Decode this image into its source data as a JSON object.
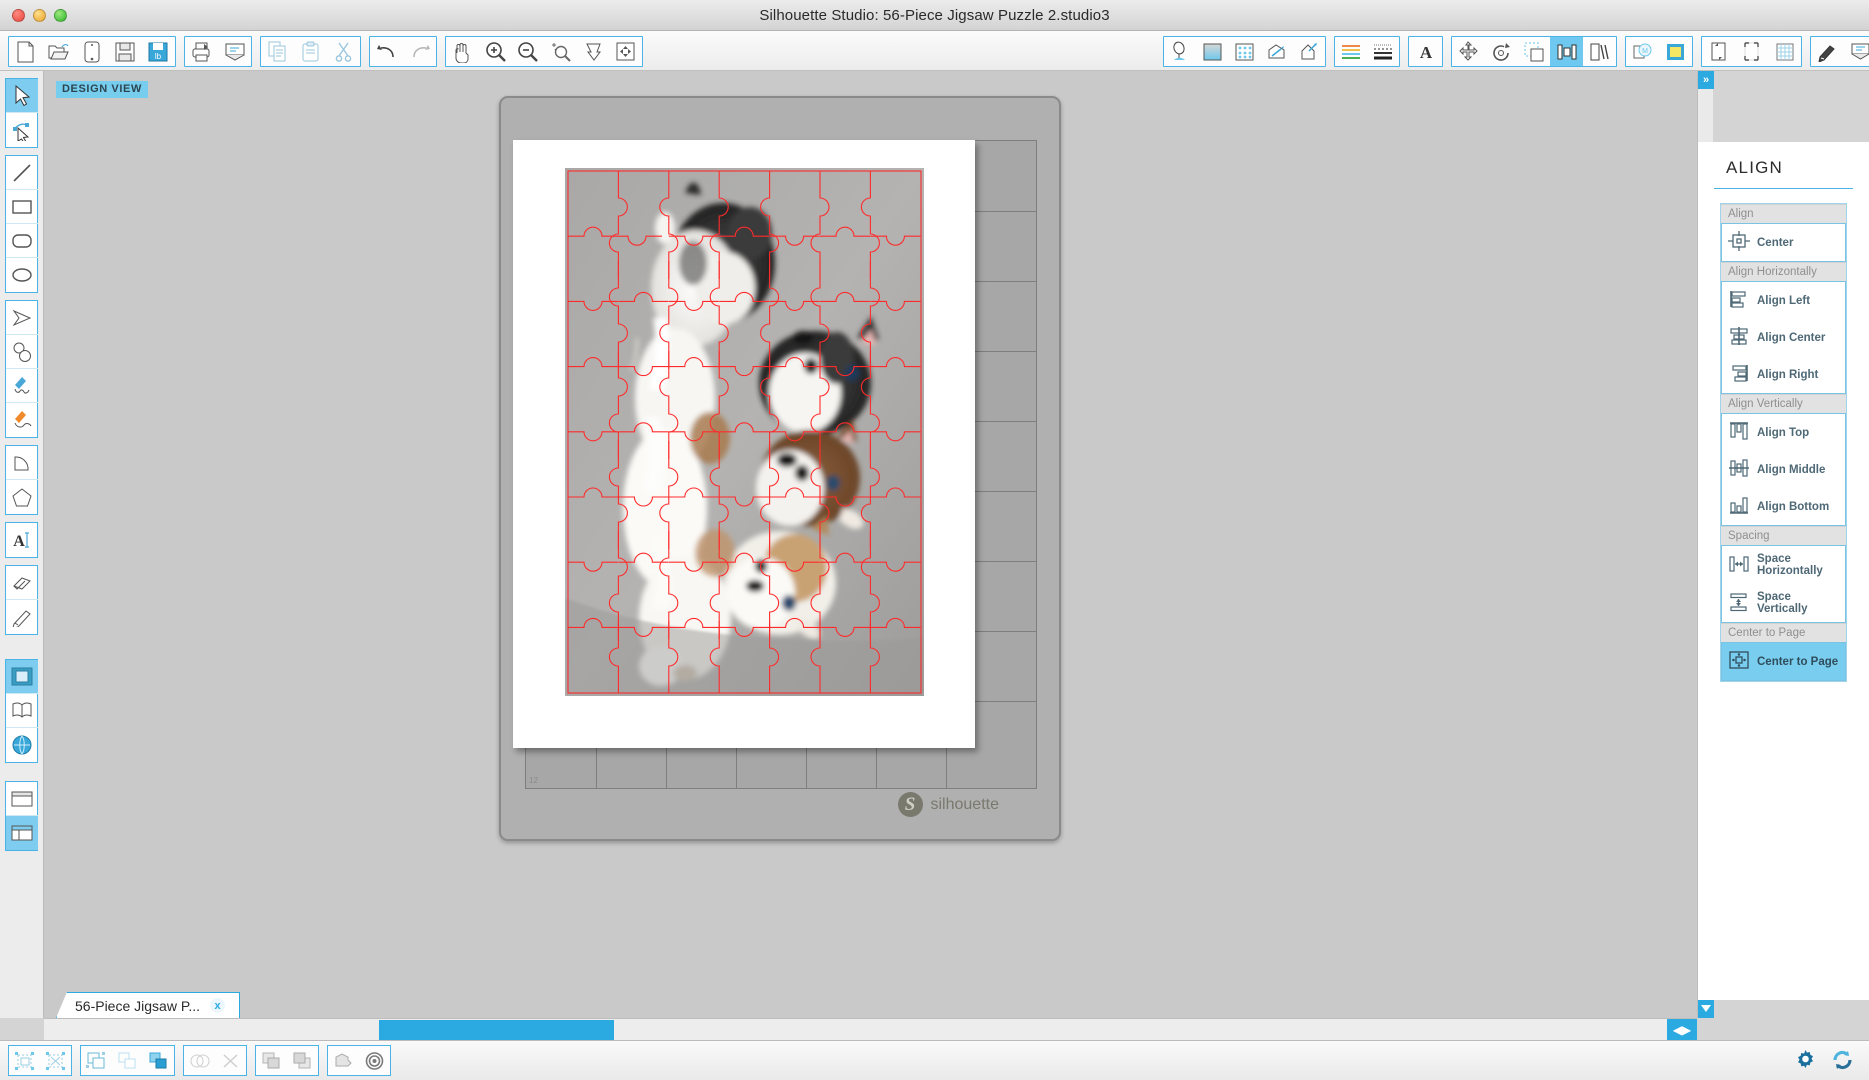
{
  "window": {
    "title": "Silhouette Studio: 56-Piece Jigsaw Puzzle 2.studio3",
    "traffic_lights": [
      "close-button",
      "minimize-button",
      "maximize-button"
    ]
  },
  "toolbar": {
    "groups": [
      {
        "name": "file-group",
        "buttons": [
          {
            "id": "new-document",
            "label": "New"
          },
          {
            "id": "open-document",
            "label": "Open"
          },
          {
            "id": "save-as-library",
            "label": "Save to Library"
          },
          {
            "id": "save-document",
            "label": "Save"
          },
          {
            "id": "save-special",
            "label": "Save Special"
          }
        ]
      },
      {
        "name": "print-group",
        "buttons": [
          {
            "id": "print",
            "label": "Print"
          },
          {
            "id": "send-to-silhouette",
            "label": "Send"
          }
        ]
      },
      {
        "name": "clipboard-group",
        "buttons": [
          {
            "id": "copy",
            "label": "Copy"
          },
          {
            "id": "paste",
            "label": "Paste"
          },
          {
            "id": "cut",
            "label": "Cut"
          }
        ]
      },
      {
        "name": "history-group",
        "buttons": [
          {
            "id": "undo",
            "label": "Undo"
          },
          {
            "id": "redo",
            "label": "Redo"
          }
        ]
      },
      {
        "name": "view-group",
        "buttons": [
          {
            "id": "pan",
            "label": "Pan"
          },
          {
            "id": "zoom-in",
            "label": "Zoom In"
          },
          {
            "id": "zoom-out",
            "label": "Zoom Out"
          },
          {
            "id": "zoom-selection",
            "label": "Zoom to Selection"
          },
          {
            "id": "fit-to-window",
            "label": "Fit to Window"
          },
          {
            "id": "fit-to-page",
            "label": "Fit to Page"
          }
        ]
      }
    ],
    "right_groups": [
      {
        "name": "style-group",
        "buttons": [
          {
            "id": "fill-color",
            "label": "Fill Color"
          },
          {
            "id": "fill-gradient",
            "label": "Gradient Fill"
          },
          {
            "id": "fill-pattern",
            "label": "Pattern Fill"
          },
          {
            "id": "line-color",
            "label": "Line Color"
          },
          {
            "id": "sketch-pen",
            "label": "Sketch Pen"
          }
        ]
      },
      {
        "name": "line-group",
        "buttons": [
          {
            "id": "line-style",
            "label": "Line Style"
          },
          {
            "id": "line-thickness",
            "label": "Line Thickness"
          }
        ]
      },
      {
        "name": "text-group",
        "buttons": [
          {
            "id": "text-style",
            "label": "Text Style"
          }
        ]
      },
      {
        "name": "transform-group",
        "buttons": [
          {
            "id": "move",
            "label": "Move"
          },
          {
            "id": "rotate",
            "label": "Rotate"
          },
          {
            "id": "scale",
            "label": "Scale"
          },
          {
            "id": "align",
            "label": "Align",
            "selected": true
          },
          {
            "id": "replicate",
            "label": "Replicate"
          }
        ]
      },
      {
        "name": "effects-group",
        "buttons": [
          {
            "id": "modify",
            "label": "Modify"
          },
          {
            "id": "offset",
            "label": "Offset"
          }
        ]
      },
      {
        "name": "page-group",
        "buttons": [
          {
            "id": "page-setup",
            "label": "Page Setup"
          },
          {
            "id": "registration-marks",
            "label": "Registration Marks"
          },
          {
            "id": "grid-settings",
            "label": "Grid"
          }
        ]
      },
      {
        "name": "cut-group",
        "buttons": [
          {
            "id": "cut-settings",
            "label": "Cut Settings"
          },
          {
            "id": "send-panel",
            "label": "Send"
          }
        ]
      }
    ]
  },
  "left_tools": {
    "groups": [
      {
        "name": "selection-group",
        "tools": [
          {
            "id": "select-tool",
            "label": "Select",
            "selected": true
          },
          {
            "id": "edit-points-tool",
            "label": "Edit Points"
          }
        ]
      },
      {
        "name": "shapes-group",
        "tools": [
          {
            "id": "line-tool",
            "label": "Line"
          },
          {
            "id": "rectangle-tool",
            "label": "Rectangle"
          },
          {
            "id": "rounded-rectangle-tool",
            "label": "Rounded Rectangle"
          },
          {
            "id": "ellipse-tool",
            "label": "Ellipse"
          }
        ]
      },
      {
        "name": "draw-group",
        "tools": [
          {
            "id": "polygon-tool",
            "label": "Polygon"
          },
          {
            "id": "curve-tool",
            "label": "Curve Shape"
          },
          {
            "id": "draw-tool",
            "label": "Draw Freehand"
          },
          {
            "id": "smooth-draw-tool",
            "label": "Draw Smooth Freehand"
          }
        ]
      },
      {
        "name": "arc-group",
        "tools": [
          {
            "id": "arc-tool",
            "label": "Arc"
          },
          {
            "id": "regular-polygon-tool",
            "label": "Regular Polygon"
          }
        ]
      },
      {
        "name": "text-group",
        "tools": [
          {
            "id": "text-tool",
            "label": "Text"
          }
        ]
      },
      {
        "name": "erase-group",
        "tools": [
          {
            "id": "eraser-tool",
            "label": "Eraser"
          },
          {
            "id": "knife-tool",
            "label": "Knife"
          }
        ]
      },
      {
        "name": "library-group",
        "tools": [
          {
            "id": "design-page-tool",
            "label": "Design Page",
            "selected": true
          },
          {
            "id": "library-tool",
            "label": "Library"
          },
          {
            "id": "store-tool",
            "label": "Silhouette Store"
          }
        ]
      },
      {
        "name": "panel-group",
        "tools": [
          {
            "id": "show-design-panel",
            "label": "Design Panel"
          },
          {
            "id": "show-split-panel",
            "label": "Split Panel"
          }
        ]
      }
    ]
  },
  "canvas": {
    "view_badge": "DESIGN VIEW",
    "mat": {
      "brand_label": "silhouette",
      "ruler_mark": "12",
      "orientation_icon": "up-arrow-icon"
    },
    "artwork": {
      "name": "husky-puppies-jigsaw-puzzle",
      "description": "Photo of husky puppies overlaid with a red jigsaw-puzzle cut path",
      "cut_line_color": "#ff2b2b",
      "puzzle_columns": 7,
      "puzzle_rows": 8,
      "piece_count": 56
    }
  },
  "scrollbars": {
    "vertical": {
      "collapse_label": "»",
      "up_down_icon": "scroll-arrows-icon"
    },
    "horizontal": {
      "arrows_label": "◀▶"
    }
  },
  "document_tab": {
    "label": "56-Piece Jigsaw P...",
    "close_label": "x"
  },
  "bottom_bar": {
    "groups": [
      {
        "name": "select-group",
        "buttons": [
          {
            "id": "select-all",
            "label": "Select All"
          },
          {
            "id": "deselect-all",
            "label": "Deselect All"
          }
        ]
      },
      {
        "name": "group-group",
        "buttons": [
          {
            "id": "group",
            "label": "Group"
          },
          {
            "id": "ungroup",
            "label": "Ungroup"
          },
          {
            "id": "make-compound-path",
            "label": "Make Compound Path"
          }
        ]
      },
      {
        "name": "weld-group",
        "buttons": [
          {
            "id": "weld",
            "label": "Weld"
          },
          {
            "id": "release-compound-path",
            "label": "Release Compound Path"
          }
        ]
      },
      {
        "name": "order-group",
        "buttons": [
          {
            "id": "bring-to-front",
            "label": "Bring to Front"
          },
          {
            "id": "send-to-back",
            "label": "Send to Back"
          }
        ]
      },
      {
        "name": "trace-group",
        "buttons": [
          {
            "id": "trace",
            "label": "Trace"
          },
          {
            "id": "registration",
            "label": "Registration"
          }
        ]
      }
    ],
    "right_buttons": [
      {
        "id": "preferences",
        "label": "Preferences",
        "icon": "gear-icon"
      },
      {
        "id": "sync",
        "label": "Sync",
        "icon": "sync-icon"
      }
    ]
  },
  "align_panel": {
    "title": "ALIGN",
    "sections": [
      {
        "heading": "Align",
        "items": [
          {
            "id": "align-center",
            "label": "Center",
            "icon": "align-center-both-icon",
            "active": false
          }
        ]
      },
      {
        "heading": "Align Horizontally",
        "items": [
          {
            "id": "align-left",
            "label": "Align Left",
            "icon": "align-left-icon",
            "active": false
          },
          {
            "id": "align-center-h",
            "label": "Align Center",
            "icon": "align-center-h-icon",
            "active": false
          },
          {
            "id": "align-right",
            "label": "Align Right",
            "icon": "align-right-icon",
            "active": false
          }
        ]
      },
      {
        "heading": "Align Vertically",
        "items": [
          {
            "id": "align-top",
            "label": "Align Top",
            "icon": "align-top-icon",
            "active": false
          },
          {
            "id": "align-middle",
            "label": "Align Middle",
            "icon": "align-middle-icon",
            "active": false
          },
          {
            "id": "align-bottom",
            "label": "Align Bottom",
            "icon": "align-bottom-icon",
            "active": false
          }
        ]
      },
      {
        "heading": "Spacing",
        "items": [
          {
            "id": "space-horizontally",
            "label": "Space Horizontally",
            "icon": "space-horizontal-icon",
            "active": false
          },
          {
            "id": "space-vertically",
            "label": "Space Vertically",
            "icon": "space-vertical-icon",
            "active": false
          }
        ]
      },
      {
        "heading": "Center to Page",
        "items": [
          {
            "id": "center-to-page",
            "label": "Center to Page",
            "icon": "center-to-page-icon",
            "active": true
          }
        ]
      }
    ]
  },
  "colors": {
    "accent": "#2aaae1",
    "accent_light": "#79cdef",
    "panel_border": "#7ac3e3",
    "cut_line": "#ff2b2b",
    "chrome": "#ececec",
    "canvas_bg": "#c9c9c9"
  }
}
